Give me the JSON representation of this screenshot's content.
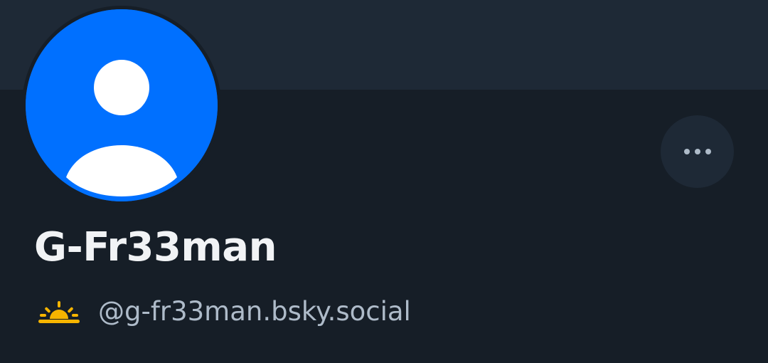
{
  "profile": {
    "display_name": "G-Fr33man",
    "handle": "@g-fr33man.bsky.social",
    "avatar_icon": "default-person-avatar-icon",
    "handle_badge_icon": "sunrise-emoji-icon"
  },
  "actions": {
    "more_icon": "ellipsis-horizontal-icon"
  },
  "colors": {
    "background": "#161e27",
    "banner": "#1e2936",
    "avatar_blue": "#0070ff",
    "more_button_bg": "#1e2936",
    "name_text": "#f1f3f5",
    "handle_text": "#aebbc9",
    "sunrise_yellow": "#f7b500"
  }
}
